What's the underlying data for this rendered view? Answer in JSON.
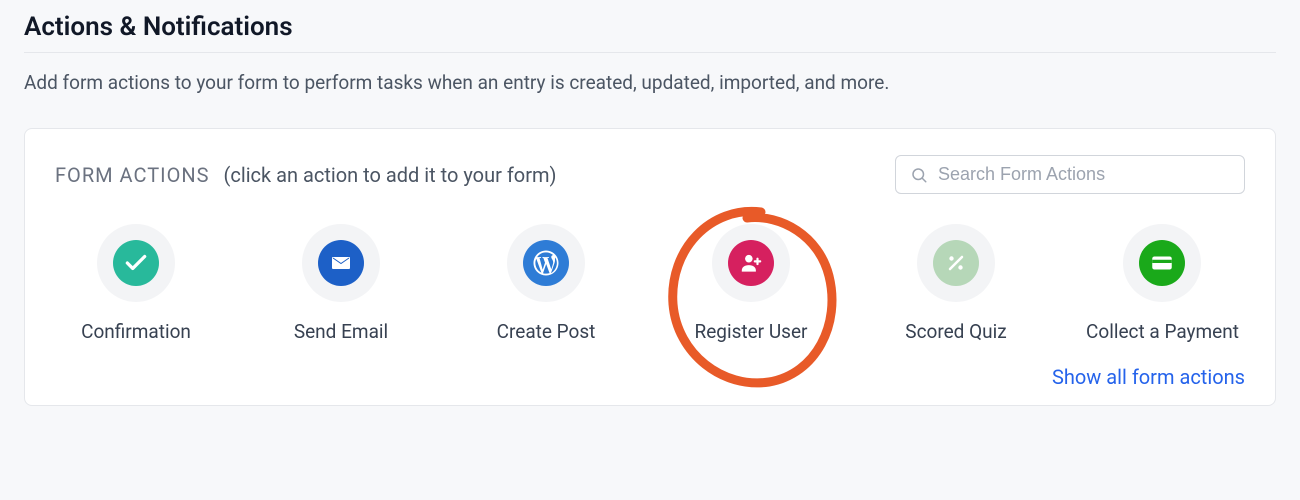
{
  "page": {
    "title": "Actions & Notifications",
    "description": "Add form actions to your form to perform tasks when an entry is created, updated, imported, and more."
  },
  "panel": {
    "label": "FORM ACTIONS",
    "hint": "(click an action to add it to your form)",
    "search_placeholder": "Search Form Actions",
    "show_all_label": "Show all form actions"
  },
  "actions": [
    {
      "label": "Confirmation",
      "icon": "check",
      "color": "#28b99b"
    },
    {
      "label": "Send Email",
      "icon": "mail",
      "color": "#1d60c7"
    },
    {
      "label": "Create Post",
      "icon": "wp",
      "color": "#2e7cd6"
    },
    {
      "label": "Register User",
      "icon": "user-add",
      "color": "#d6205f",
      "highlighted": true
    },
    {
      "label": "Scored Quiz",
      "icon": "percent",
      "color": "#b6d7b8"
    },
    {
      "label": "Collect a Payment",
      "icon": "card",
      "color": "#1aa91a"
    }
  ]
}
